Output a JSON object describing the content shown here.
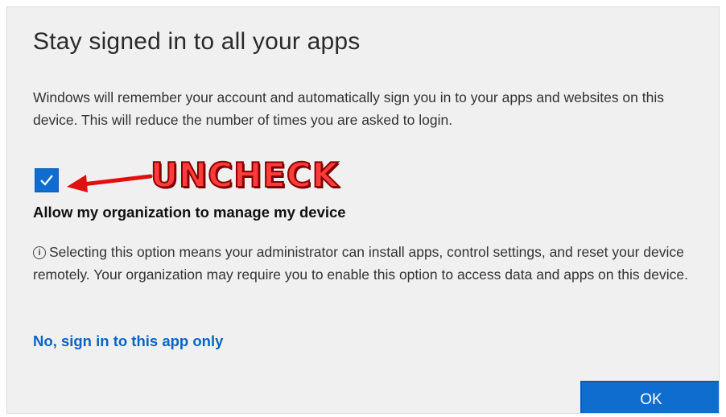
{
  "dialog": {
    "title": "Stay signed in to all your apps",
    "description": "Windows will remember your account and automatically sign you in to your apps and websites on this device. This will reduce the number of times you are asked to login.",
    "checkbox": {
      "checked": true,
      "label": "Allow my organization to manage my device"
    },
    "info_icon": "info-circle-icon",
    "info_glyph": "i",
    "info_text": "Selecting this option means your administrator can install apps, control settings, and reset your device remotely. Your organization may require you to enable this option to access data and apps on this device.",
    "alt_link": "No, sign in to this app only",
    "ok_label": "OK"
  },
  "annotation": {
    "text": "UNCHECK",
    "color": "#ff3b3b"
  },
  "colors": {
    "background": "#f0f0f0",
    "accent": "#0f6dd0",
    "link": "#0a63c9"
  }
}
